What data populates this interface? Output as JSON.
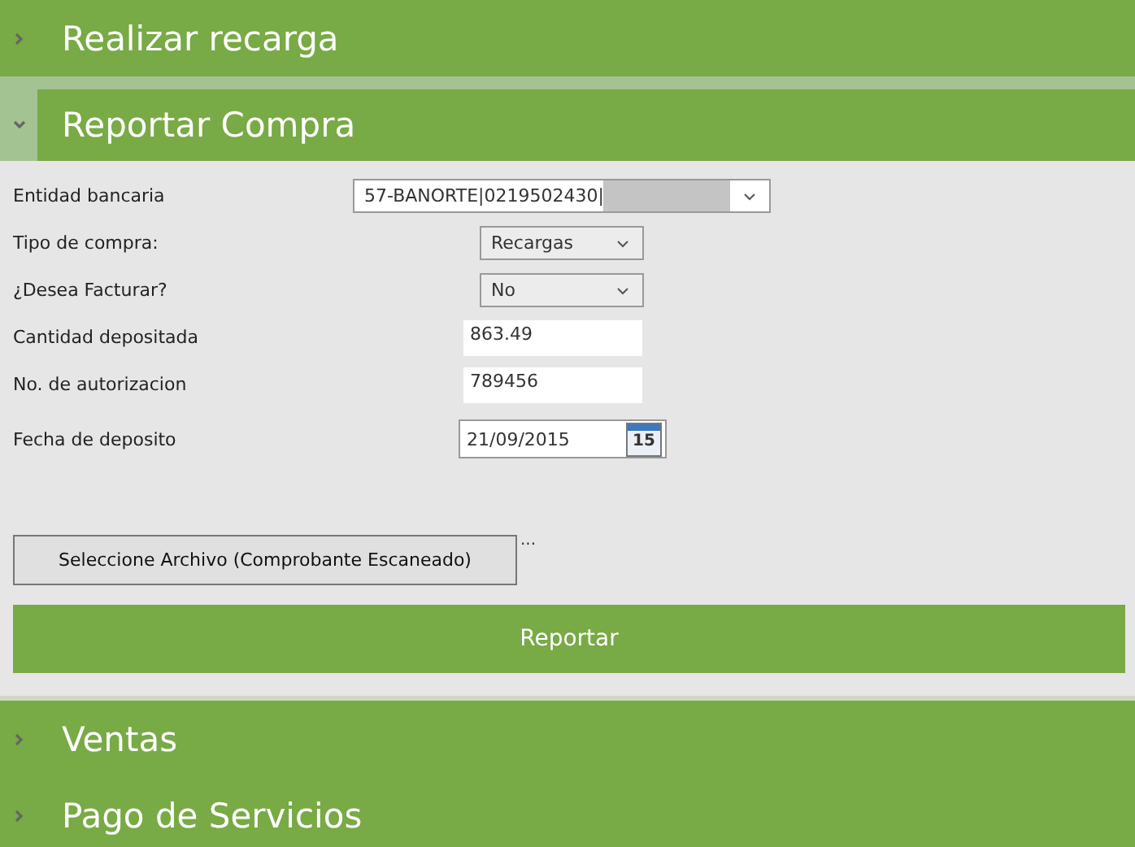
{
  "sections": [
    {
      "title": "Realizar recarga",
      "expanded": false
    },
    {
      "title": "Reportar Compra",
      "expanded": true,
      "form": {
        "fields": [
          {
            "kind": "select",
            "label": "Entidad bancaria",
            "value": "57-BANORTE|0219502430|",
            "redacted": true
          },
          {
            "kind": "select",
            "label": "Tipo de compra:",
            "value": "Recargas"
          },
          {
            "kind": "select",
            "label": "¿Desea Facturar?",
            "value": "No"
          },
          {
            "kind": "text",
            "label": "Cantidad depositada",
            "value": "863.49"
          },
          {
            "kind": "text",
            "label": "No. de autorizacion",
            "value": "789456"
          },
          {
            "kind": "date",
            "label": "Fecha de deposito",
            "value": "21/09/2015",
            "calendar_day": "15"
          }
        ],
        "file_button": "Seleccione Archivo (Comprobante Escaneado)",
        "file_status": "...",
        "submit": "Reportar"
      }
    },
    {
      "title": "Ventas",
      "expanded": false
    },
    {
      "title": "Pago de Servicios",
      "expanded": false
    }
  ]
}
